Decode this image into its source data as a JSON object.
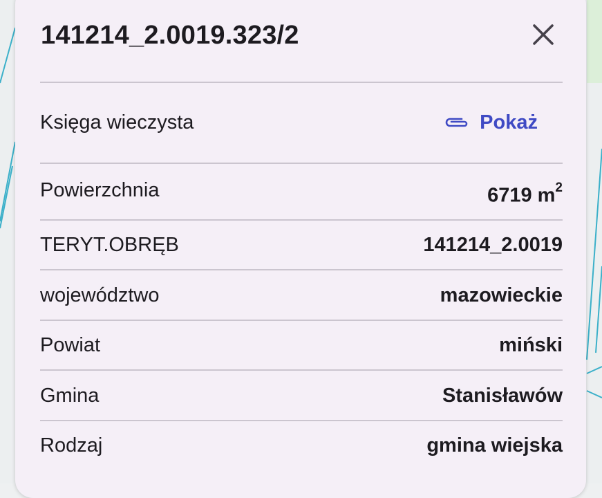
{
  "panel": {
    "title": "141214_2.0019.323/2",
    "close_icon": "close-icon"
  },
  "land_register": {
    "label": "Księga wieczysta",
    "link_label": "Pokaż",
    "link_icon": "paperclip-icon",
    "link_color": "#3f4ac4"
  },
  "attributes": [
    {
      "label": "Powierzchnia",
      "value": "6719 m",
      "unit_exponent": "2"
    },
    {
      "label": "TERYT.OBRĘB",
      "value": "141214_2.0019"
    },
    {
      "label": "województwo",
      "value": "mazowieckie"
    },
    {
      "label": "Powiat",
      "value": "miński"
    },
    {
      "label": "Gmina",
      "value": "Stanisławów"
    },
    {
      "label": "Rodzaj",
      "value": "gmina wiejska"
    }
  ],
  "colors": {
    "panel_background": "#f5eff7",
    "text": "#1d1b20",
    "divider": "#cbc5cf",
    "map_parcel_lines": "#3bb0c9"
  }
}
